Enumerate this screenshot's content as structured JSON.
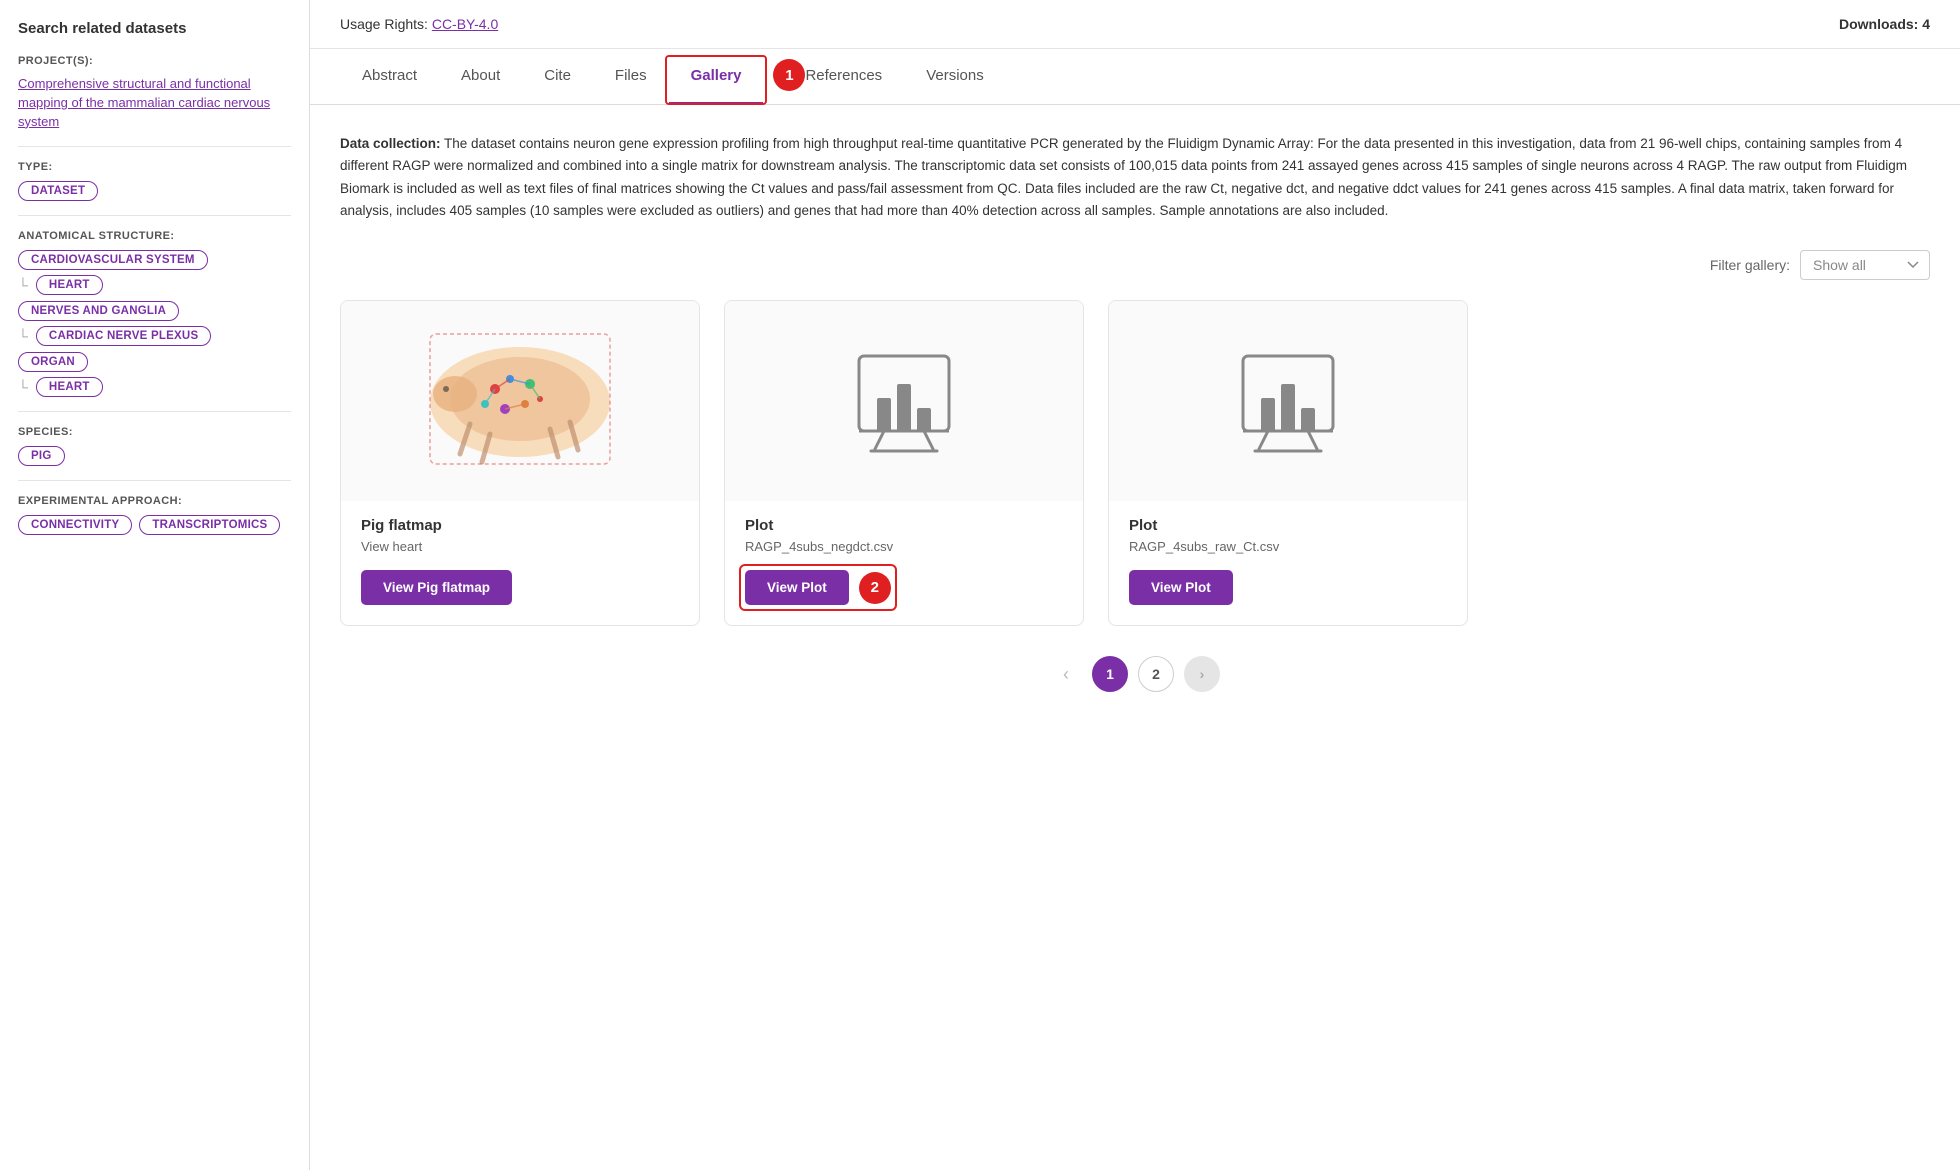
{
  "sidebar": {
    "title": "Search related datasets",
    "projects_label": "PROJECT(S):",
    "project_link": "Comprehensive structural and functional mapping of the mammalian cardiac nervous system",
    "type_label": "TYPE:",
    "type_tag": "DATASET",
    "anatomical_label": "ANATOMICAL STRUCTURE:",
    "anatomical_tags": [
      {
        "name": "CARDIOVASCULAR SYSTEM",
        "children": [
          "HEART"
        ]
      },
      {
        "name": "NERVES AND GANGLIA",
        "children": [
          "CARDIAC NERVE PLEXUS"
        ]
      },
      {
        "name": "ORGAN",
        "children": [
          "HEART"
        ]
      }
    ],
    "species_label": "SPECIES:",
    "species_tags": [
      "PIG"
    ],
    "experimental_label": "EXPERIMENTAL APPROACH:",
    "experimental_tags": [
      "CONNECTIVITY",
      "TRANSCRIPTOMICS"
    ]
  },
  "topbar": {
    "usage_rights_label": "Usage Rights:",
    "usage_rights_link": "CC-BY-4.0",
    "downloads_label": "Downloads: 4"
  },
  "tabs": {
    "items": [
      "Abstract",
      "About",
      "Cite",
      "Files",
      "Gallery",
      "References",
      "Versions"
    ],
    "active_index": 4
  },
  "steps": {
    "step1_label": "1",
    "step2_label": "2"
  },
  "content": {
    "data_collection_bold": "Data collection:",
    "data_collection_text": "  The dataset contains neuron gene expression profiling from high throughput real-time quantitative PCR generated by the Fluidigm Dynamic Array: For the data presented in this investigation, data from 21 96-well chips, containing samples from 4 different RAGP were normalized and combined into a single matrix for downstream analysis. The transcriptomic data set consists of 100,015 data points from 241 assayed genes across 415 samples of single neurons across 4 RAGP. The raw output from Fluidigm Biomark is included as well as text files of final matrices showing the Ct values and pass/fail assessment from QC. Data files included are the raw Ct, negative dct, and negative ddct values for 241 genes across 415 samples. A final data matrix, taken forward for analysis, includes 405 samples (10 samples were excluded as outliers) and genes that had more than 40% detection across all samples. Sample annotations are also included."
  },
  "filter": {
    "label": "Filter gallery:",
    "value": "Show all"
  },
  "gallery": {
    "cards": [
      {
        "type": "flatmap",
        "title": "Pig flatmap",
        "subtitle": "View heart",
        "button_label": "View Pig flatmap"
      },
      {
        "type": "plot",
        "title": "Plot",
        "subtitle": "RAGP_4subs_negdct.csv",
        "button_label": "View Plot"
      },
      {
        "type": "plot",
        "title": "Plot",
        "subtitle": "RAGP_4subs_raw_Ct.csv",
        "button_label": "View Plot"
      }
    ]
  },
  "pagination": {
    "prev_arrow": "‹",
    "next_arrow": "›",
    "pages": [
      "1",
      "2"
    ],
    "active_page": 0
  }
}
